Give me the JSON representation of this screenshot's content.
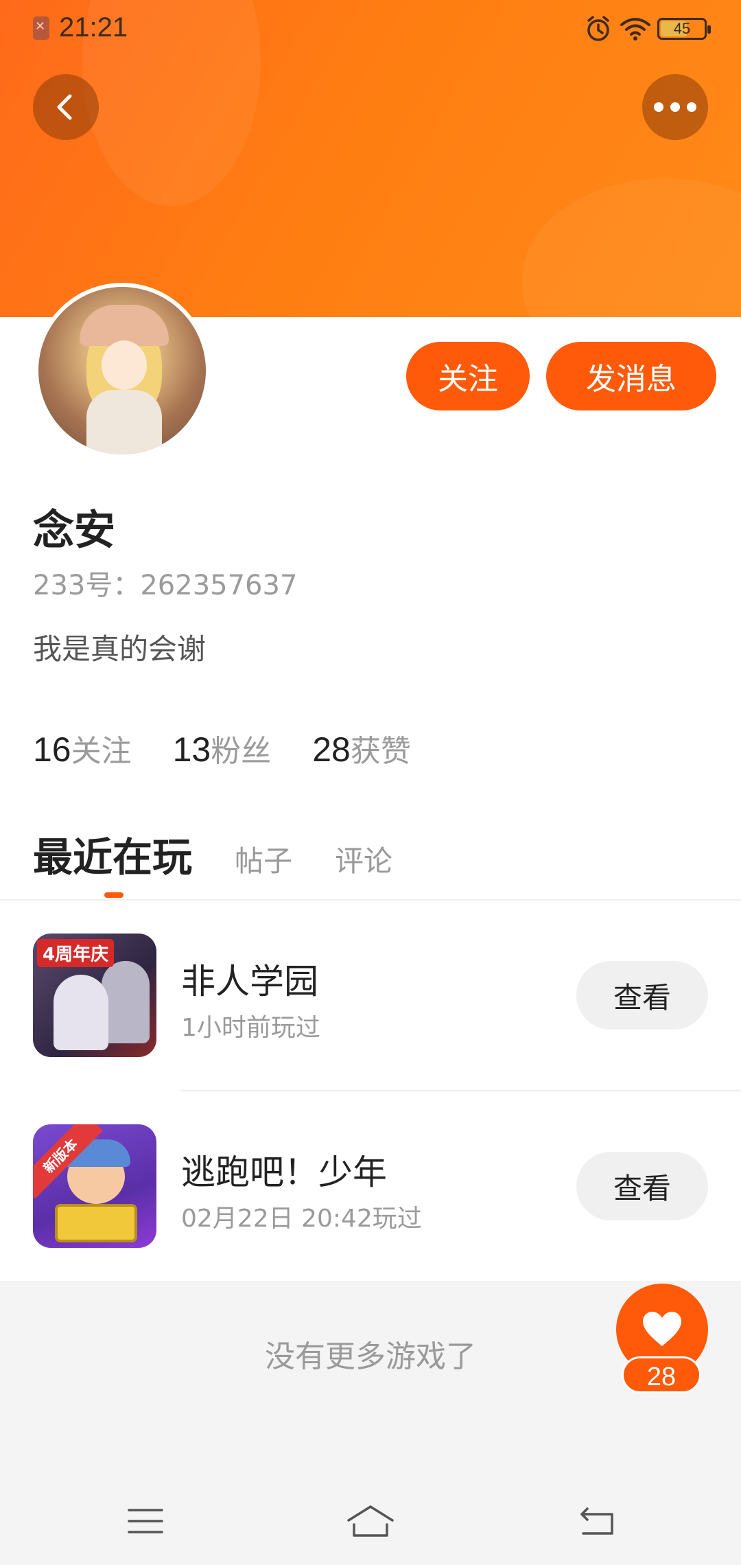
{
  "status_bar": {
    "time": "21:21",
    "battery": "45",
    "icons": [
      "sim-error-icon",
      "alarm-icon",
      "wifi-icon",
      "battery-icon"
    ]
  },
  "header": {
    "back_icon": "chevron-left-icon",
    "more_icon": "more-dots-icon",
    "accent_color": "#ff6a1a"
  },
  "profile": {
    "name": "念安",
    "id_text": "233号：262357637",
    "bio": "我是真的会谢",
    "follow_label": "关注",
    "message_label": "发消息"
  },
  "stats": [
    {
      "num": "16",
      "label": "关注"
    },
    {
      "num": "13",
      "label": "粉丝"
    },
    {
      "num": "28",
      "label": "获赞"
    }
  ],
  "tabs": [
    "最近在玩",
    "帖子",
    "评论"
  ],
  "games": [
    {
      "title": "非人学园",
      "sub": "1小时前玩过",
      "button": "查看",
      "badge": "4周年庆"
    },
    {
      "title": "逃跑吧！少年",
      "sub": "02月22日 20:42玩过",
      "button": "查看",
      "badge": "新版本"
    }
  ],
  "footer": {
    "no_more": "没有更多游戏了",
    "like_count": "28"
  },
  "nav": {
    "icons": [
      "menu-icon",
      "home-icon",
      "back-icon"
    ]
  },
  "colors": {
    "primary": "#ff5a0a",
    "text_secondary": "#9a9a9a"
  }
}
